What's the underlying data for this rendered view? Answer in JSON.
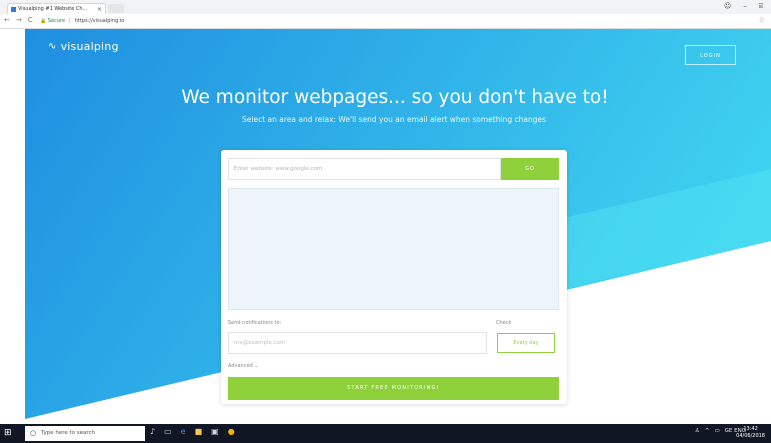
{
  "browser": {
    "tab_title": "Visualping #1 Website Ch...",
    "tab_close": "×",
    "nav_back": "←",
    "nav_forward": "→",
    "nav_reload": "C",
    "secure_label": "Secure",
    "url": "https://visualping.io",
    "window_controls": [
      "☺",
      "–",
      "⌸"
    ],
    "star": "☆"
  },
  "header": {
    "brand": "visualping",
    "login_label": "LOGIN"
  },
  "hero": {
    "headline": "We monitor webpages... so you don't have to!",
    "subline": "Select an area and relax: We'll send you an email alert when something changes"
  },
  "form": {
    "url_placeholder": "Enter website: www.google.com",
    "go_label": "GO",
    "notify_label": "Send notifications to:",
    "check_label": "Check",
    "email_placeholder": "me@example.com",
    "frequency_value": "Every day",
    "advanced_label": "Advanced",
    "start_label": "START FREE MONITORING!"
  },
  "taskbar": {
    "search_placeholder": "Type here to search",
    "tray_text": "GE ENG",
    "time": "13:42",
    "date": "04/06/2018"
  },
  "colors": {
    "hero_from": "#1f8ee0",
    "hero_to": "#3fd2f0",
    "accent_green": "#8fd13a",
    "taskbar": "#101624"
  }
}
